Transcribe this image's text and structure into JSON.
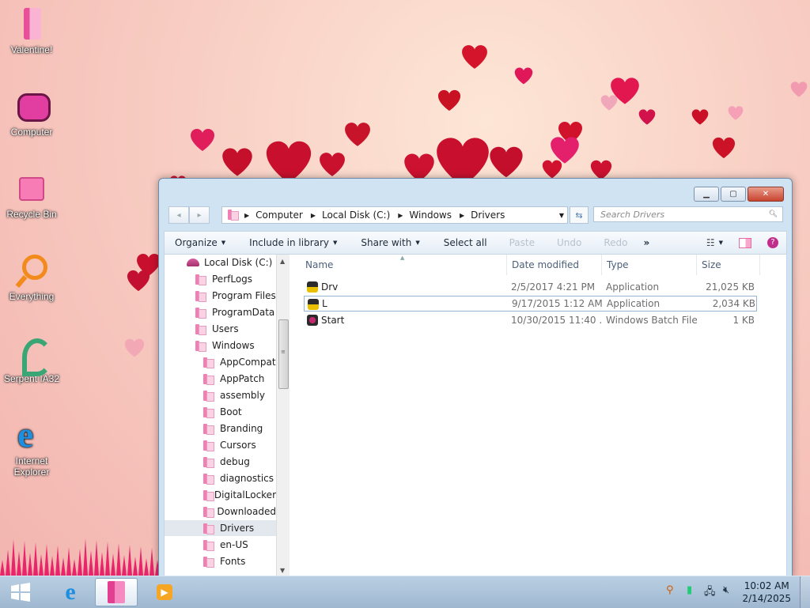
{
  "desktop": {
    "icons": [
      {
        "label": "Valentine!",
        "icon": "valentine-folder-icon"
      },
      {
        "label": "Computer",
        "icon": "computer-icon"
      },
      {
        "label": "Recycle Bin",
        "icon": "recycle-bin-icon"
      },
      {
        "label": "Everything",
        "icon": "everything-search-icon"
      },
      {
        "label": "Serpent IA32",
        "icon": "serpent-icon"
      },
      {
        "label": "Internet Explorer",
        "icon": "internet-explorer-icon"
      }
    ]
  },
  "explorer": {
    "back_icon": "◂",
    "forward_icon": "▸",
    "breadcrumb": [
      "Computer",
      "Local Disk (C:)",
      "Windows",
      "Drivers"
    ],
    "search_placeholder": "Search Drivers",
    "toolbar": {
      "organize": "Organize",
      "include_in_library": "Include in library",
      "share_with": "Share with",
      "select_all": "Select all",
      "paste": "Paste",
      "undo": "Undo",
      "redo": "Redo",
      "more": "»"
    },
    "tree": [
      {
        "label": "Local Disk (C:)",
        "level": 0,
        "type": "disk"
      },
      {
        "label": "PerfLogs",
        "level": 1
      },
      {
        "label": "Program Files",
        "level": 1
      },
      {
        "label": "ProgramData",
        "level": 1
      },
      {
        "label": "Users",
        "level": 1
      },
      {
        "label": "Windows",
        "level": 1
      },
      {
        "label": "AppCompat",
        "level": 2
      },
      {
        "label": "AppPatch",
        "level": 2
      },
      {
        "label": "assembly",
        "level": 2
      },
      {
        "label": "Boot",
        "level": 2
      },
      {
        "label": "Branding",
        "level": 2
      },
      {
        "label": "Cursors",
        "level": 2
      },
      {
        "label": "debug",
        "level": 2
      },
      {
        "label": "diagnostics",
        "level": 2
      },
      {
        "label": "DigitalLocker",
        "level": 2
      },
      {
        "label": "Downloaded",
        "level": 2
      },
      {
        "label": "Drivers",
        "level": 2,
        "selected": true
      },
      {
        "label": "en-US",
        "level": 2
      },
      {
        "label": "Fonts",
        "level": 2
      }
    ],
    "columns": [
      "Name",
      "Date modified",
      "Type",
      "Size"
    ],
    "files": [
      {
        "name": "Drv",
        "date": "2/5/2017 4:21 PM",
        "type": "Application",
        "size": "21,025 KB",
        "icon": "application-icon"
      },
      {
        "name": "L",
        "date": "9/17/2015 1:12 AM",
        "type": "Application",
        "size": "2,034 KB",
        "icon": "application-icon",
        "selected": true
      },
      {
        "name": "Start",
        "date": "10/30/2015 11:40 ...",
        "type": "Windows Batch File",
        "size": "1 KB",
        "icon": "batch-file-icon"
      }
    ]
  },
  "taskbar": {
    "clock_time": "10:02 AM",
    "clock_date": "2/14/2025"
  },
  "colors": {
    "accent": "#f07fb4",
    "heart": "#c8102e",
    "taskbar": "#a9c1d8"
  }
}
